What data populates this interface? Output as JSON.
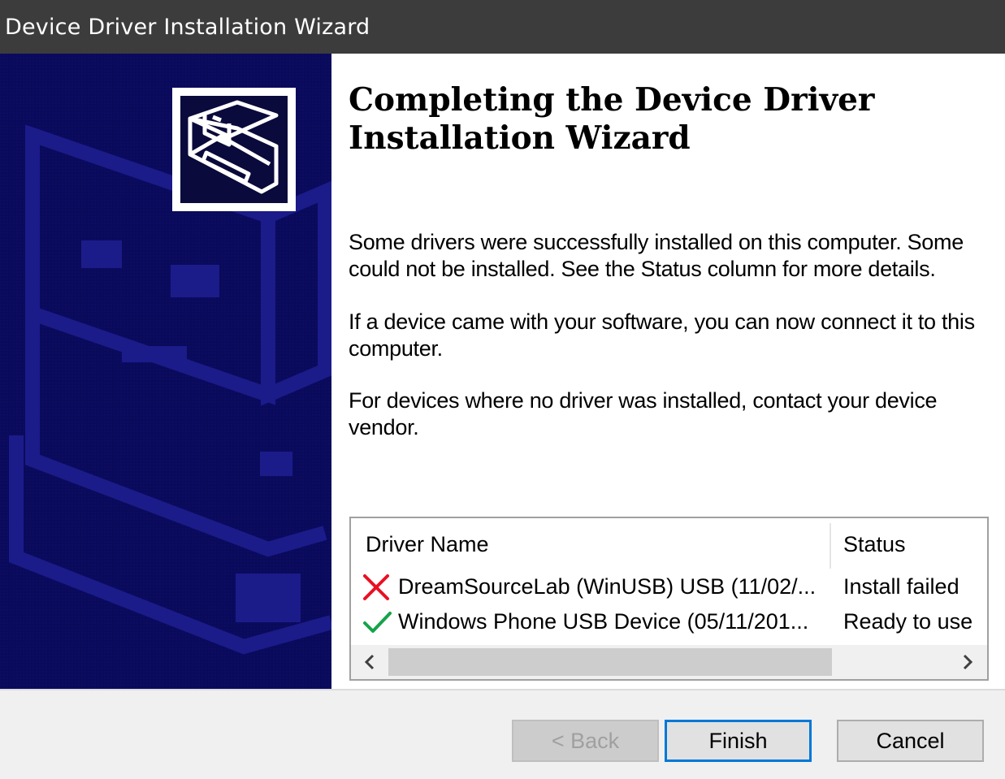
{
  "window": {
    "title": "Device Driver Installation Wizard"
  },
  "main": {
    "heading": "Completing the Device Driver Installation Wizard",
    "paragraphs": [
      "Some drivers were successfully installed on this computer. Some could not be installed. See the Status column for more details.",
      "If a device came with your software, you can now connect it to this computer.",
      "For devices where no driver was installed, contact your device vendor."
    ]
  },
  "driver_list": {
    "columns": [
      "Driver Name",
      "Status"
    ],
    "rows": [
      {
        "name": "DreamSourceLab (WinUSB) USB (11/02/...",
        "status": "Install failed",
        "icon": "red-x-icon"
      },
      {
        "name": "Windows Phone USB Device (05/11/201...",
        "status": "Ready to use",
        "icon": "green-check-icon"
      }
    ]
  },
  "buttons": {
    "back": "< Back",
    "finish": "Finish",
    "cancel": "Cancel"
  },
  "colors": {
    "side_panel": "#0a0a5a",
    "titlebar": "#3c3c3c",
    "focus": "#0078d7",
    "error": "#e81123",
    "success": "#16a34a"
  }
}
